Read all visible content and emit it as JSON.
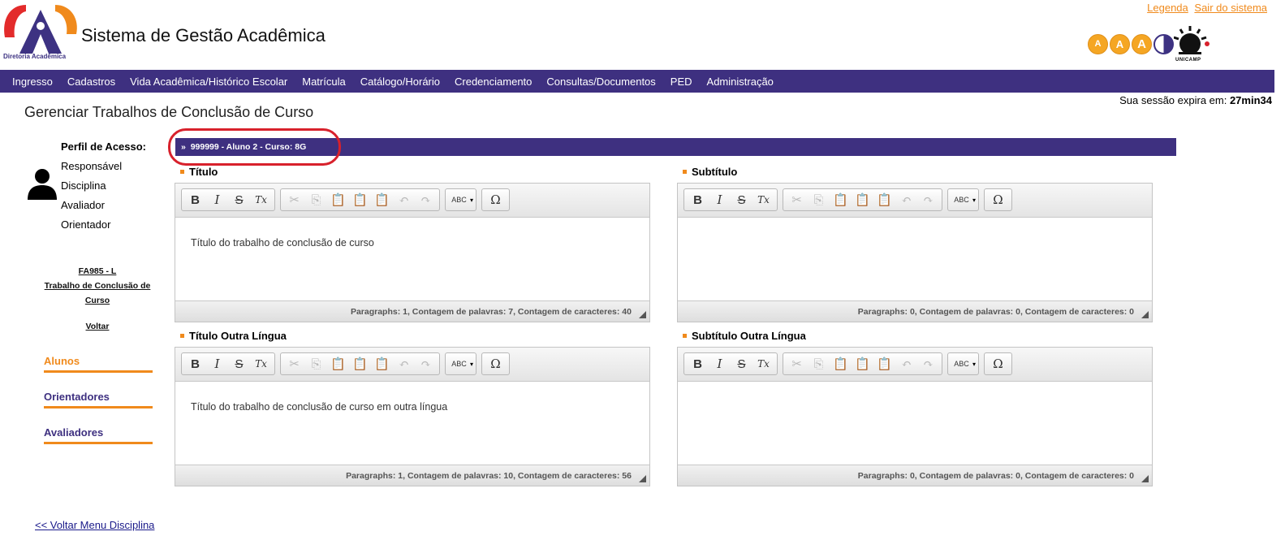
{
  "header": {
    "system_title": "Sistema de Gestão Acadêmica",
    "logo_caption": "Diretoria Acadêmica",
    "links": [
      "Legenda",
      "Sair do sistema"
    ],
    "accessibility": [
      "A",
      "A",
      "A"
    ],
    "unicamp_label": "UNICAMP"
  },
  "nav": {
    "items": [
      "Ingresso",
      "Cadastros",
      "Vida Acadêmica/Histórico Escolar",
      "Matrícula",
      "Catálogo/Horário",
      "Credenciamento",
      "Consultas/Documentos",
      "PED",
      "Administração"
    ]
  },
  "session": {
    "prefix": "Sua sessão expira em:",
    "time": "27min34"
  },
  "page_title": "Gerenciar Trabalhos de Conclusão de Curso",
  "perfil": {
    "title": "Perfil de Acesso:",
    "items": [
      "Responsável",
      "Disciplina",
      "Avaliador",
      "Orientador"
    ]
  },
  "disciplina": {
    "code": "FA985 - L",
    "name": "Trabalho de Conclusão de Curso",
    "back": "Voltar"
  },
  "sidebar": {
    "links": [
      "Alunos",
      "Orientadores",
      "Avaliadores"
    ]
  },
  "student_bar": {
    "arrow": "»",
    "text": "999999 - Aluno 2 - Curso: 8G"
  },
  "fields": {
    "titulo": {
      "label": "Título",
      "content": "Título do trabalho de conclusão de curso",
      "status": "Paragraphs: 1, Contagem de palavras: 7, Contagem de caracteres: 40"
    },
    "subtitulo": {
      "label": "Subtítulo",
      "content": "",
      "status": "Paragraphs: 0, Contagem de palavras: 0, Contagem de caracteres: 0"
    },
    "titulo_outra": {
      "label": "Título Outra Língua",
      "content": "Título do trabalho de conclusão de curso em outra língua",
      "status": "Paragraphs: 1, Contagem de palavras: 10, Contagem de caracteres: 56"
    },
    "subtitulo_outra": {
      "label": "Subtítulo Outra Língua",
      "content": "",
      "status": "Paragraphs: 0, Contagem de palavras: 0, Contagem de caracteres: 0"
    }
  },
  "toolbar": {
    "bold": "B",
    "italic": "I",
    "strike": "S",
    "remove_format": "Tx",
    "spellcheck": "ABC",
    "special_char": "Ω"
  },
  "footer": {
    "back_menu": "<< Voltar Menu Disciplina"
  },
  "colors": {
    "brand_purple": "#3e3080",
    "accent_orange": "#f08a1c",
    "highlight_red": "#d8212c"
  }
}
